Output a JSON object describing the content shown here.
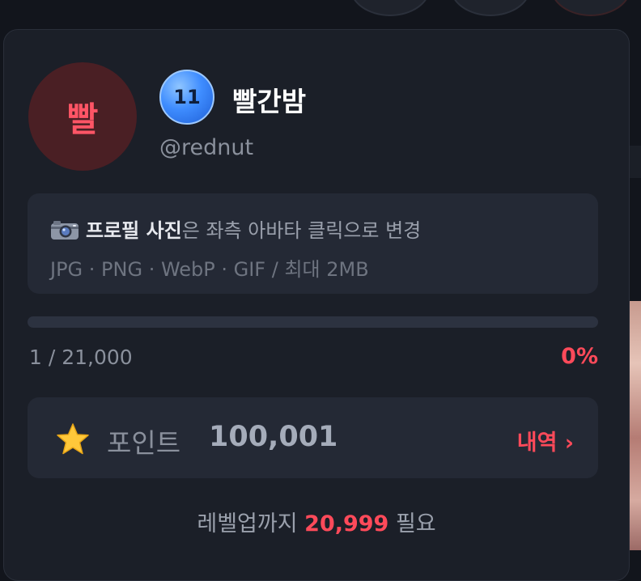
{
  "profile": {
    "avatar_text": "빨",
    "level": "11",
    "name": "빨간밤",
    "handle": "@rednut"
  },
  "info": {
    "bold_text": "프로필 사진",
    "rest_text": "은 좌측 아바타 클릭으로 변경",
    "formats": "JPG · PNG · WebP · GIF / 최대 2MB",
    "icon": "camera-icon"
  },
  "progress": {
    "count": "1 / 21,000",
    "percent": "0%",
    "fill_fraction": 0.0
  },
  "points": {
    "icon": "star-icon",
    "label": "포인트",
    "value": "100,001",
    "history_link": "내역 ›"
  },
  "levelup": {
    "prefix": "레벨업까지 ",
    "value": "20,999",
    "suffix": " 필요"
  },
  "colors": {
    "accent": "#ff4a5a",
    "card_bg": "#1b1f28",
    "panel_bg": "#242935",
    "badge_blue": "#3f8dff"
  }
}
